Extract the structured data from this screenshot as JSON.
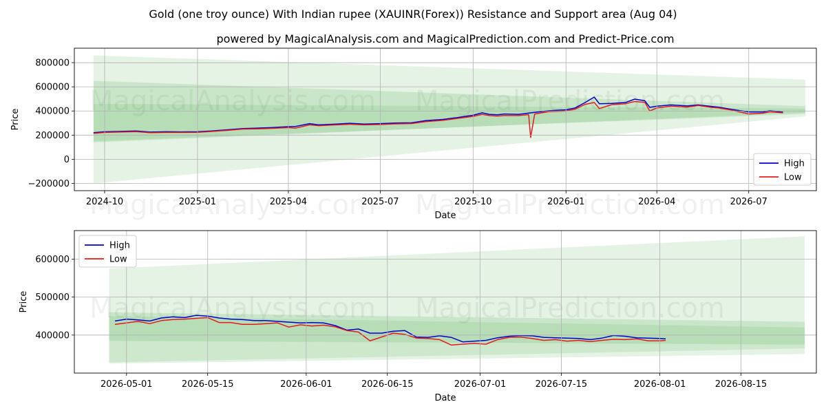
{
  "title": "Gold (one troy ounce) With Indian rupee (XAUINR(Forex)) Resistance and Support area (Aug 04)",
  "subtitle": "powered by MagicalAnalysis.com and MagicalPrediction.com and Predict-Price.com",
  "watermarks": [
    "MagicalAnalysis.com",
    "MagicalPrediction.com"
  ],
  "colors": {
    "high": "#0000cc",
    "low": "#e31a1c",
    "band": "#2ca02c"
  },
  "chart_data": [
    {
      "type": "line",
      "xlabel": "Date",
      "ylabel": "Price",
      "xlim": [
        "2024-09-01",
        "2026-09-06"
      ],
      "ylim": [
        -260000,
        920000
      ],
      "xticks": [
        {
          "date": "2024-10-01",
          "label": "2024-10"
        },
        {
          "date": "2025-01-01",
          "label": "2025-01"
        },
        {
          "date": "2025-04-01",
          "label": "2025-04"
        },
        {
          "date": "2025-07-01",
          "label": "2025-07"
        },
        {
          "date": "2025-10-01",
          "label": "2025-10"
        },
        {
          "date": "2026-01-01",
          "label": "2026-01"
        },
        {
          "date": "2026-04-01",
          "label": "2026-04"
        },
        {
          "date": "2026-07-01",
          "label": "2026-07"
        }
      ],
      "yticks": [
        {
          "value": -200000,
          "label": "−200000"
        },
        {
          "value": 0,
          "label": "0"
        },
        {
          "value": 200000,
          "label": "200000"
        },
        {
          "value": 400000,
          "label": "400000"
        },
        {
          "value": 600000,
          "label": "600000"
        },
        {
          "value": 800000,
          "label": "800000"
        }
      ],
      "legend": {
        "position": "lower-right",
        "entries": [
          "High",
          "Low"
        ]
      },
      "grid": true,
      "bands": [
        {
          "start": "2024-09-20",
          "end": "2026-08-26",
          "upper": [
            860000,
            660000
          ],
          "lower": [
            -200000,
            355000
          ],
          "opacity": 0.12
        },
        {
          "start": "2024-09-20",
          "end": "2026-08-26",
          "upper": [
            650000,
            440000
          ],
          "lower": [
            140000,
            385000
          ],
          "opacity": 0.15
        },
        {
          "start": "2024-09-20",
          "end": "2026-08-26",
          "upper": [
            460000,
            420000
          ],
          "lower": [
            150000,
            375000
          ],
          "opacity": 0.12
        }
      ],
      "series": [
        {
          "name": "High",
          "x": [
            "2024-09-20",
            "2024-10-01",
            "2024-10-15",
            "2024-11-01",
            "2024-11-15",
            "2024-12-01",
            "2024-12-15",
            "2025-01-01",
            "2025-01-15",
            "2025-02-01",
            "2025-02-15",
            "2025-03-01",
            "2025-03-15",
            "2025-04-01",
            "2025-04-08",
            "2025-04-22",
            "2025-05-01",
            "2025-05-15",
            "2025-06-01",
            "2025-06-15",
            "2025-07-01",
            "2025-07-15",
            "2025-08-01",
            "2025-08-15",
            "2025-09-01",
            "2025-09-15",
            "2025-10-01",
            "2025-10-10",
            "2025-10-17",
            "2025-10-25",
            "2025-11-01",
            "2025-11-15",
            "2025-12-01",
            "2025-12-15",
            "2026-01-01",
            "2026-01-10",
            "2026-01-20",
            "2026-01-29",
            "2026-02-03",
            "2026-02-15",
            "2026-03-01",
            "2026-03-10",
            "2026-03-20",
            "2026-03-25",
            "2026-04-01",
            "2026-04-15",
            "2026-05-01",
            "2026-05-12",
            "2026-05-25",
            "2026-06-01",
            "2026-06-15",
            "2026-07-01",
            "2026-07-15",
            "2026-07-22",
            "2026-08-04"
          ],
          "values": [
            220000,
            228000,
            230000,
            235000,
            225000,
            228000,
            227000,
            228000,
            235000,
            245000,
            255000,
            258000,
            262000,
            270000,
            272000,
            295000,
            285000,
            290000,
            298000,
            292000,
            295000,
            300000,
            302000,
            320000,
            330000,
            345000,
            365000,
            385000,
            372000,
            368000,
            375000,
            372000,
            388000,
            402000,
            410000,
            425000,
            470000,
            515000,
            460000,
            462000,
            470000,
            498000,
            485000,
            430000,
            440000,
            450000,
            442000,
            450000,
            438000,
            432000,
            412000,
            392000,
            392000,
            402000,
            390000
          ]
        },
        {
          "name": "Low",
          "x": [
            "2024-09-20",
            "2024-10-01",
            "2024-10-15",
            "2024-11-01",
            "2024-11-15",
            "2024-12-01",
            "2024-12-15",
            "2025-01-01",
            "2025-01-15",
            "2025-02-01",
            "2025-02-15",
            "2025-03-01",
            "2025-03-15",
            "2025-04-01",
            "2025-04-08",
            "2025-04-22",
            "2025-05-01",
            "2025-05-15",
            "2025-06-01",
            "2025-06-15",
            "2025-07-01",
            "2025-07-15",
            "2025-08-01",
            "2025-08-15",
            "2025-09-01",
            "2025-09-15",
            "2025-10-01",
            "2025-10-10",
            "2025-10-17",
            "2025-10-25",
            "2025-11-01",
            "2025-11-15",
            "2025-11-25",
            "2025-11-27",
            "2025-12-01",
            "2025-12-15",
            "2026-01-01",
            "2026-01-10",
            "2026-01-20",
            "2026-01-29",
            "2026-02-03",
            "2026-02-15",
            "2026-03-01",
            "2026-03-10",
            "2026-03-20",
            "2026-03-25",
            "2026-04-01",
            "2026-04-15",
            "2026-05-01",
            "2026-05-12",
            "2026-05-25",
            "2026-06-01",
            "2026-06-15",
            "2026-07-01",
            "2026-07-15",
            "2026-07-22",
            "2026-08-04"
          ],
          "values": [
            215000,
            222000,
            225000,
            229000,
            220000,
            222000,
            222000,
            223000,
            230000,
            240000,
            250000,
            252000,
            256000,
            262000,
            258000,
            285000,
            278000,
            284000,
            290000,
            285000,
            288000,
            293000,
            296000,
            312000,
            322000,
            338000,
            355000,
            372000,
            362000,
            358000,
            362000,
            362000,
            370000,
            180000,
            375000,
            395000,
            400000,
            415000,
            455000,
            470000,
            420000,
            452000,
            460000,
            478000,
            472000,
            400000,
            425000,
            440000,
            432000,
            445000,
            430000,
            425000,
            405000,
            375000,
            382000,
            393000,
            385000
          ]
        }
      ]
    },
    {
      "type": "line",
      "xlabel": "Date",
      "ylabel": "Price",
      "xlim": [
        "2026-04-22",
        "2026-08-28"
      ],
      "ylim": [
        300000,
        675000
      ],
      "xticks": [
        {
          "date": "2026-05-01",
          "label": "2026-05-01"
        },
        {
          "date": "2026-05-15",
          "label": "2026-05-15"
        },
        {
          "date": "2026-06-01",
          "label": "2026-06-01"
        },
        {
          "date": "2026-06-15",
          "label": "2026-06-15"
        },
        {
          "date": "2026-07-01",
          "label": "2026-07-01"
        },
        {
          "date": "2026-07-15",
          "label": "2026-07-15"
        },
        {
          "date": "2026-08-01",
          "label": "2026-08-01"
        },
        {
          "date": "2026-08-15",
          "label": "2026-08-15"
        }
      ],
      "yticks": [
        {
          "value": 400000,
          "label": "400000"
        },
        {
          "value": 500000,
          "label": "500000"
        },
        {
          "value": 600000,
          "label": "600000"
        }
      ],
      "legend": {
        "position": "upper-left",
        "entries": [
          "High",
          "Low"
        ]
      },
      "grid": true,
      "bands": [
        {
          "start": "2026-04-28",
          "end": "2026-08-26",
          "upper": [
            575000,
            660000
          ],
          "lower": [
            325000,
            350000
          ],
          "opacity": 0.12
        },
        {
          "start": "2026-04-28",
          "end": "2026-08-26",
          "upper": [
            460000,
            435000
          ],
          "lower": [
            385000,
            375000
          ],
          "opacity": 0.15
        },
        {
          "start": "2026-04-28",
          "end": "2026-08-26",
          "upper": [
            450000,
            420000
          ],
          "lower": [
            328000,
            365000
          ],
          "opacity": 0.12
        }
      ],
      "series": [
        {
          "name": "High",
          "x": [
            "2026-04-29",
            "2026-05-01",
            "2026-05-03",
            "2026-05-05",
            "2026-05-07",
            "2026-05-09",
            "2026-05-11",
            "2026-05-13",
            "2026-05-15",
            "2026-05-17",
            "2026-05-19",
            "2026-05-21",
            "2026-05-23",
            "2026-05-25",
            "2026-05-27",
            "2026-05-29",
            "2026-05-31",
            "2026-06-02",
            "2026-06-04",
            "2026-06-06",
            "2026-06-08",
            "2026-06-10",
            "2026-06-12",
            "2026-06-14",
            "2026-06-16",
            "2026-06-18",
            "2026-06-20",
            "2026-06-22",
            "2026-06-24",
            "2026-06-26",
            "2026-06-28",
            "2026-06-30",
            "2026-07-02",
            "2026-07-04",
            "2026-07-06",
            "2026-07-08",
            "2026-07-10",
            "2026-07-12",
            "2026-07-14",
            "2026-07-16",
            "2026-07-18",
            "2026-07-20",
            "2026-07-22",
            "2026-07-24",
            "2026-07-26",
            "2026-07-28",
            "2026-07-30",
            "2026-08-01",
            "2026-08-02"
          ],
          "values": [
            437000,
            442000,
            440000,
            437000,
            445000,
            448000,
            446000,
            452000,
            450000,
            445000,
            442000,
            441000,
            438000,
            438000,
            436000,
            434000,
            432000,
            433000,
            432000,
            425000,
            413000,
            416000,
            405000,
            405000,
            410000,
            412000,
            395000,
            394000,
            398000,
            394000,
            382000,
            384000,
            386000,
            393000,
            397000,
            399000,
            398000,
            394000,
            393000,
            392000,
            391000,
            388000,
            392000,
            399000,
            397000,
            393000,
            392000,
            391000,
            390000
          ]
        },
        {
          "name": "Low",
          "x": [
            "2026-04-29",
            "2026-05-01",
            "2026-05-03",
            "2026-05-05",
            "2026-05-07",
            "2026-05-09",
            "2026-05-11",
            "2026-05-13",
            "2026-05-15",
            "2026-05-17",
            "2026-05-19",
            "2026-05-21",
            "2026-05-23",
            "2026-05-25",
            "2026-05-27",
            "2026-05-29",
            "2026-05-31",
            "2026-06-02",
            "2026-06-04",
            "2026-06-06",
            "2026-06-08",
            "2026-06-10",
            "2026-06-12",
            "2026-06-14",
            "2026-06-16",
            "2026-06-18",
            "2026-06-20",
            "2026-06-22",
            "2026-06-24",
            "2026-06-26",
            "2026-06-28",
            "2026-06-30",
            "2026-07-02",
            "2026-07-04",
            "2026-07-06",
            "2026-07-08",
            "2026-07-10",
            "2026-07-12",
            "2026-07-14",
            "2026-07-16",
            "2026-07-18",
            "2026-07-20",
            "2026-07-22",
            "2026-07-24",
            "2026-07-26",
            "2026-07-28",
            "2026-07-30",
            "2026-08-01",
            "2026-08-02"
          ],
          "values": [
            428000,
            432000,
            436000,
            430000,
            438000,
            441000,
            442000,
            444000,
            446000,
            433000,
            433000,
            428000,
            428000,
            430000,
            432000,
            421000,
            427000,
            424000,
            426000,
            422000,
            412000,
            408000,
            385000,
            395000,
            405000,
            402000,
            392000,
            391000,
            388000,
            374000,
            376000,
            378000,
            376000,
            388000,
            394000,
            395000,
            391000,
            386000,
            388000,
            384000,
            386000,
            383000,
            386000,
            389000,
            388000,
            390000,
            385000,
            385000,
            386000
          ]
        }
      ]
    }
  ]
}
